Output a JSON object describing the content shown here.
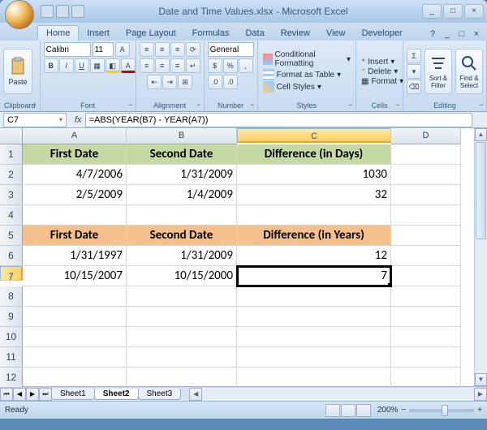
{
  "window": {
    "title": "Date and Time Values.xlsx - Microsoft Excel"
  },
  "ribbon": {
    "tabs": [
      "Home",
      "Insert",
      "Page Layout",
      "Formulas",
      "Data",
      "Review",
      "View",
      "Developer"
    ],
    "active_tab": "Home",
    "clipboard": {
      "paste": "Paste",
      "label": "Clipboard"
    },
    "font": {
      "name": "Calibri",
      "size": "11",
      "label": "Font"
    },
    "alignment": {
      "label": "Alignment"
    },
    "number": {
      "format": "General",
      "label": "Number"
    },
    "styles": {
      "cond": "Conditional Formatting",
      "table": "Format as Table",
      "cell": "Cell Styles",
      "label": "Styles"
    },
    "cells": {
      "insert": "Insert",
      "delete": "Delete",
      "format": "Format",
      "label": "Cells"
    },
    "editing": {
      "sort": "Sort & Filter",
      "find": "Find & Select",
      "label": "Editing"
    }
  },
  "namebox": "C7",
  "formula": "=ABS(YEAR(B7) - YEAR(A7))",
  "columns": [
    "A",
    "B",
    "C",
    "D"
  ],
  "row_numbers": [
    "1",
    "2",
    "3",
    "4",
    "5",
    "6",
    "7",
    "8",
    "9",
    "10",
    "11",
    "12"
  ],
  "sheet": {
    "r1": {
      "a": "First Date",
      "b": "Second Date",
      "c": "Difference (in Days)"
    },
    "r2": {
      "a": "4/7/2006",
      "b": "1/31/2009",
      "c": "1030"
    },
    "r3": {
      "a": "2/5/2009",
      "b": "1/4/2009",
      "c": "32"
    },
    "r5": {
      "a": "First Date",
      "b": "Second Date",
      "c": "Difference (in Years)"
    },
    "r6": {
      "a": "1/31/1997",
      "b": "1/31/2009",
      "c": "12"
    },
    "r7": {
      "a": "10/15/2007",
      "b": "10/15/2000",
      "c": "7"
    }
  },
  "sheets": {
    "s1": "Sheet1",
    "s2": "Sheet2",
    "s3": "Sheet3"
  },
  "status": {
    "text": "Ready",
    "zoom": "200%"
  },
  "chart_data": null
}
